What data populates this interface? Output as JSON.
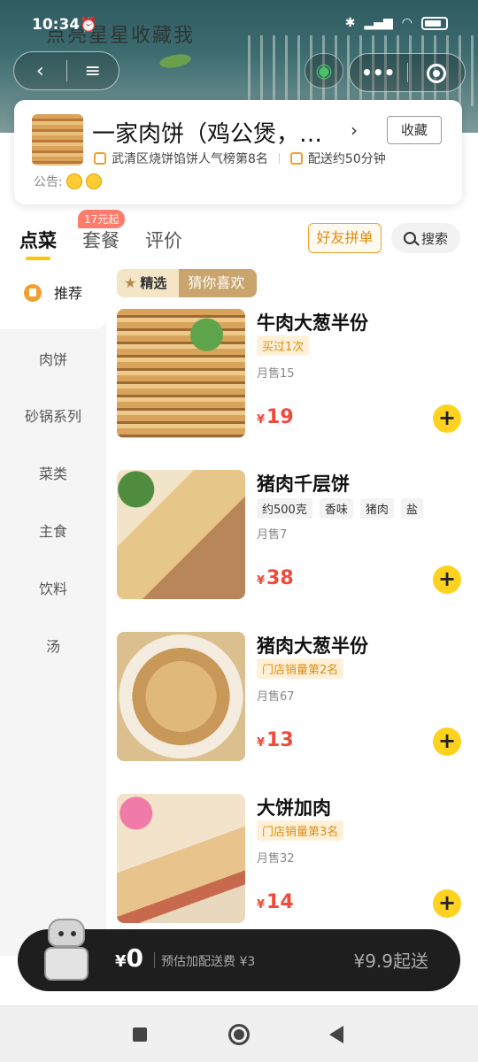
{
  "status_bar": {
    "time": "10:34",
    "alarm_icon": "alarm-clock-icon",
    "icons": [
      "bluetooth-icon",
      "signal-icon",
      "wifi-icon",
      "battery-icon"
    ]
  },
  "banner": {
    "slogan": "点亮星星收藏我"
  },
  "nav": {
    "back_icon": "chevron-left-icon",
    "menu_icon": "hamburger-icon",
    "more_icon": "more-dots-icon",
    "target_icon": "target-icon",
    "share_icon": "wechat-icon"
  },
  "store": {
    "name": "一家肉饼（鸡公煲，…",
    "favorite_label": "收藏",
    "ranking": "武清区烧饼馅饼人气榜第8名",
    "delivery_time": "配送约50分钟",
    "notice_label": "公告:"
  },
  "tabs": [
    {
      "label": "点菜",
      "active": true
    },
    {
      "label": "套餐",
      "badge": "17元起"
    },
    {
      "label": "评价"
    }
  ],
  "group_buy_label": "好友拼单",
  "search_label": "搜索",
  "sidebar": [
    {
      "label": "推荐",
      "active": true
    },
    {
      "label": "肉饼"
    },
    {
      "label": "砂锅系列"
    },
    {
      "label": "菜类"
    },
    {
      "label": "主食"
    },
    {
      "label": "饮料"
    },
    {
      "label": "汤"
    }
  ],
  "section": {
    "featured_label": "精选",
    "like_label": "猜你喜欢"
  },
  "dishes": [
    {
      "name": "牛肉大葱半份",
      "chip": "买过1次",
      "sold": "月售15",
      "currency": "¥",
      "price": "19"
    },
    {
      "name": "猪肉千层饼",
      "specs": [
        "约500克",
        "香味",
        "猪肉",
        "盐"
      ],
      "sold": "月售7",
      "currency": "¥",
      "price": "38"
    },
    {
      "name": "猪肉大葱半份",
      "chip": "门店销量第2名",
      "sold": "月售67",
      "currency": "¥",
      "price": "13"
    },
    {
      "name": "大饼加肉",
      "chip": "门店销量第3名",
      "sold": "月售32",
      "currency": "¥",
      "price": "14"
    }
  ],
  "cart": {
    "currency": "¥",
    "total": "0",
    "fee_text": "预估加配送费 ¥3",
    "min_order": "¥9.9起送"
  },
  "colors": {
    "accent": "#ffc300",
    "price": "#f04a3b",
    "cart_bg": "#1e1e1e"
  }
}
